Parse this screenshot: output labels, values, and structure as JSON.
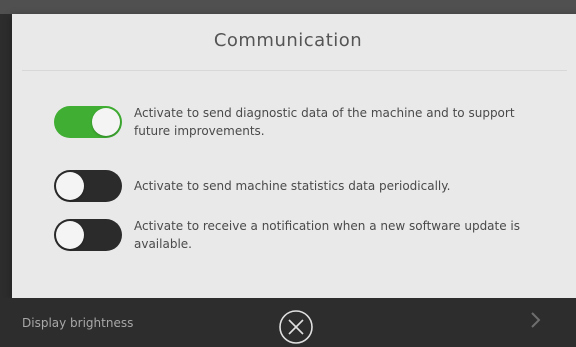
{
  "dialog": {
    "title": "Communication",
    "settings": [
      {
        "label": "Activate to send diagnostic data of the machine and to support future improvements.",
        "enabled": true
      },
      {
        "label": "Activate to send machine statistics data periodically.",
        "enabled": false
      },
      {
        "label": "Activate to receive a notification when a new software update is available.",
        "enabled": false
      }
    ]
  },
  "background": {
    "menu_item_label": "Display brightness",
    "chevron_icon": "chevron-right-icon"
  },
  "close": {
    "icon": "close-circle-icon"
  },
  "colors": {
    "toggle_on": "#3fae32",
    "toggle_off": "#2b2b2b",
    "dialog_bg": "#e9e9e9",
    "backdrop": "#2d2d2d"
  }
}
